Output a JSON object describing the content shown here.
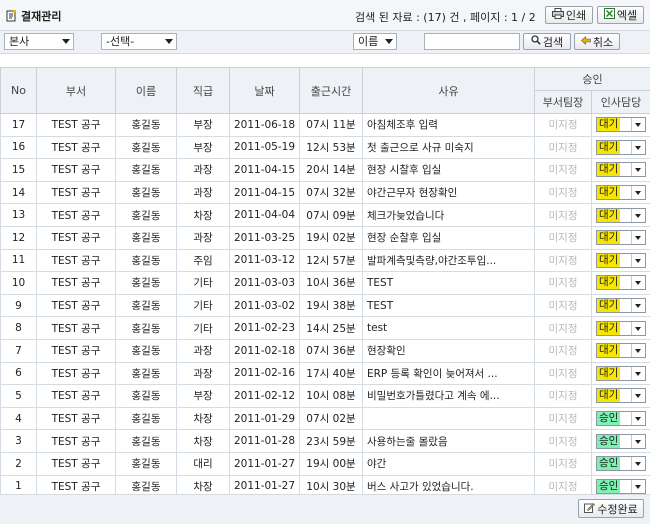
{
  "header": {
    "title": "결재관리",
    "info": "검색 된 자료 : (17) 건  , 페이지 : 1 / 2",
    "print_label": "인쇄",
    "excel_label": "엑셀"
  },
  "filters": {
    "company": "본사",
    "select_placeholder": "-선택-",
    "field": "이름",
    "search_label": "검색",
    "cancel_label": "취소"
  },
  "table": {
    "headers": {
      "no": "No",
      "dept": "부서",
      "name": "이름",
      "position": "직급",
      "date": "날짜",
      "time": "출근시간",
      "reason": "사유",
      "approval": "승인",
      "dept_head": "부서팀장",
      "hr": "인사담당"
    },
    "rows": [
      {
        "no": "17",
        "dept": "TEST 공구",
        "name": "홍길동",
        "position": "부장",
        "date": "2011-06-18",
        "time": "07시 11분",
        "reason": "아침체조후 입력",
        "dept_head": "미지정",
        "hr": "대기",
        "hr_color": "#f7e600"
      },
      {
        "no": "16",
        "dept": "TEST 공구",
        "name": "홍길동",
        "position": "부장",
        "date": "2011-05-19",
        "time": "12시 53분",
        "reason": "첫 출근으로 사규 미숙지",
        "dept_head": "미지정",
        "hr": "대기",
        "hr_color": "#f7e600"
      },
      {
        "no": "15",
        "dept": "TEST 공구",
        "name": "홍길동",
        "position": "과장",
        "date": "2011-04-15",
        "time": "20시 14분",
        "reason": "현장 시찰후 입실",
        "dept_head": "미지정",
        "hr": "대기",
        "hr_color": "#f7e600"
      },
      {
        "no": "14",
        "dept": "TEST 공구",
        "name": "홍길동",
        "position": "과장",
        "date": "2011-04-15",
        "time": "07시 32분",
        "reason": "야간근무자 현장확인",
        "dept_head": "미지정",
        "hr": "대기",
        "hr_color": "#f7e600"
      },
      {
        "no": "13",
        "dept": "TEST 공구",
        "name": "홍길동",
        "position": "차장",
        "date": "2011-04-04",
        "time": "07시 09분",
        "reason": "체크가늦었습니다",
        "dept_head": "미지정",
        "hr": "대기",
        "hr_color": "#f7e600"
      },
      {
        "no": "12",
        "dept": "TEST 공구",
        "name": "홍길동",
        "position": "과장",
        "date": "2011-03-25",
        "time": "19시 02분",
        "reason": "현장 순찰후 입실",
        "dept_head": "미지정",
        "hr": "대기",
        "hr_color": "#f7e600"
      },
      {
        "no": "11",
        "dept": "TEST 공구",
        "name": "홍길동",
        "position": "주임",
        "date": "2011-03-12",
        "time": "12시 57분",
        "reason": "발파계측및측량,야간조투입...",
        "dept_head": "미지정",
        "hr": "대기",
        "hr_color": "#f7e600"
      },
      {
        "no": "10",
        "dept": "TEST 공구",
        "name": "홍길동",
        "position": "기타",
        "date": "2011-03-03",
        "time": "10시 36분",
        "reason": "TEST",
        "dept_head": "미지정",
        "hr": "대기",
        "hr_color": "#f7e600"
      },
      {
        "no": "9",
        "dept": "TEST 공구",
        "name": "홍길동",
        "position": "기타",
        "date": "2011-03-02",
        "time": "19시 38분",
        "reason": "TEST",
        "dept_head": "미지정",
        "hr": "대기",
        "hr_color": "#f7e600"
      },
      {
        "no": "8",
        "dept": "TEST 공구",
        "name": "홍길동",
        "position": "기타",
        "date": "2011-02-23",
        "time": "14시 25분",
        "reason": "test",
        "dept_head": "미지정",
        "hr": "대기",
        "hr_color": "#f7e600"
      },
      {
        "no": "7",
        "dept": "TEST 공구",
        "name": "홍길동",
        "position": "과장",
        "date": "2011-02-18",
        "time": "07시 36분",
        "reason": "현장확인",
        "dept_head": "미지정",
        "hr": "대기",
        "hr_color": "#f7e600"
      },
      {
        "no": "6",
        "dept": "TEST 공구",
        "name": "홍길동",
        "position": "과장",
        "date": "2011-02-16",
        "time": "17시 40분",
        "reason": "ERP 등록 확인이 늦어져서 ...",
        "dept_head": "미지정",
        "hr": "대기",
        "hr_color": "#f7e600"
      },
      {
        "no": "5",
        "dept": "TEST 공구",
        "name": "홍길동",
        "position": "부장",
        "date": "2011-02-12",
        "time": "10시 08분",
        "reason": "비밀번호가틀렸다고 계속 에...",
        "dept_head": "미지정",
        "hr": "대기",
        "hr_color": "#f7e600"
      },
      {
        "no": "4",
        "dept": "TEST 공구",
        "name": "홍길동",
        "position": "차장",
        "date": "2011-01-29",
        "time": "07시 02분",
        "reason": "",
        "dept_head": "미지정",
        "hr": "승인",
        "hr_color": "#7df0b2"
      },
      {
        "no": "3",
        "dept": "TEST 공구",
        "name": "홍길동",
        "position": "차장",
        "date": "2011-01-28",
        "time": "23시 59분",
        "reason": "사용하는줄 몰랐음",
        "dept_head": "미지정",
        "hr": "승인",
        "hr_color": "#7df0b2"
      },
      {
        "no": "2",
        "dept": "TEST 공구",
        "name": "홍길동",
        "position": "대리",
        "date": "2011-01-27",
        "time": "19시 00분",
        "reason": "야간",
        "dept_head": "미지정",
        "hr": "승인",
        "hr_color": "#7df0b2"
      },
      {
        "no": "1",
        "dept": "TEST 공구",
        "name": "홍길동",
        "position": "차장",
        "date": "2011-01-27",
        "time": "10시 30분",
        "reason": "버스 사고가 있었습니다.",
        "dept_head": "미지정",
        "hr": "승인",
        "hr_color": "#7df0b2"
      }
    ]
  },
  "footer": {
    "save_label": "수정완료"
  }
}
